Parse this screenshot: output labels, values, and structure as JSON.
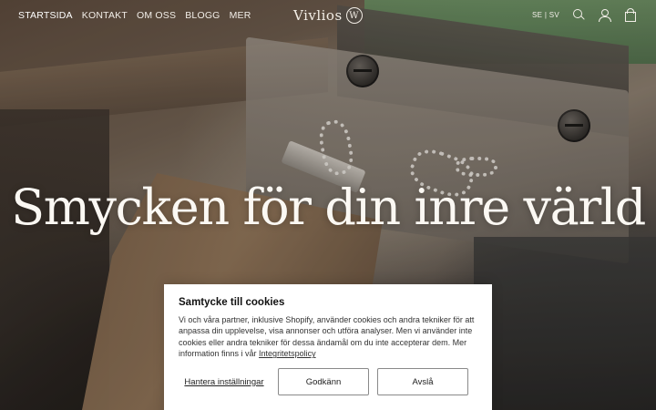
{
  "header": {
    "nav": [
      {
        "label": "STARTSIDA",
        "active": true
      },
      {
        "label": "KONTAKT",
        "active": false
      },
      {
        "label": "OM OSS",
        "active": false
      },
      {
        "label": "BLOGG",
        "active": false
      },
      {
        "label": "MER",
        "active": false
      }
    ],
    "logo_text": "Vivlios",
    "logo_mark": "W",
    "locale": "SE | SV",
    "icons": [
      "search-icon",
      "account-icon",
      "cart-icon"
    ]
  },
  "hero": {
    "title": "Smycken för din inre värld"
  },
  "cookie": {
    "title": "Samtycke till cookies",
    "body": "Vi och våra partner, inklusive Shopify, använder cookies och andra tekniker för att anpassa din upplevelse, visa annonser och utföra analyser. Men vi använder inte cookies eller andra tekniker för dessa ändamål om du inte accepterar dem. Mer information finns i vår ",
    "policy_link": "Integritetspolicy",
    "manage_label": "Hantera inställningar",
    "accept_label": "Godkänn",
    "decline_label": "Avslå"
  },
  "colors": {
    "nav_text": "#f2eee8",
    "cookie_bg": "#ffffff",
    "button_border": "#8a8a8a"
  }
}
